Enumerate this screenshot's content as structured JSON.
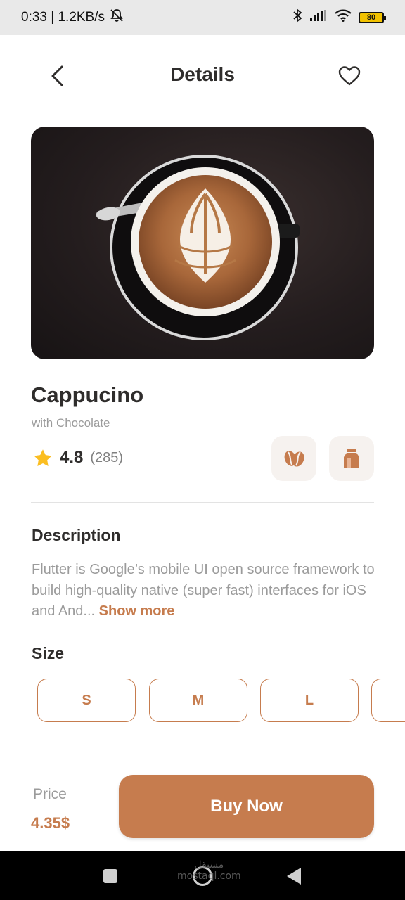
{
  "status_bar": {
    "time_speed": "0:33 | 1.2KB/s",
    "battery": "80",
    "icons": [
      "mute-icon",
      "bluetooth-icon",
      "signal-icon",
      "wifi-icon",
      "battery-icon"
    ]
  },
  "header": {
    "title": "Details",
    "back_icon": "chevron-left-icon",
    "favorite_icon": "heart-outline-icon"
  },
  "product": {
    "name": "Cappucino",
    "subtitle": "with Chocolate",
    "rating": "4.8",
    "rating_count": "(285)",
    "features": [
      "coffee-bean-icon",
      "milk-icon"
    ]
  },
  "description": {
    "title": "Description",
    "text": "Flutter is Google’s mobile UI open source framework to build high-quality native (super fast) interfaces for iOS and And...",
    "show_more": "Show more"
  },
  "size": {
    "title": "Size",
    "options": [
      "S",
      "M",
      "L"
    ]
  },
  "purchase": {
    "price_label": "Price",
    "price": "4.35$",
    "buy_label": "Buy Now"
  },
  "nav": {
    "watermark_line1": "مستقل",
    "watermark_line2": "mostaql.com"
  },
  "colors": {
    "accent": "#c67c4e",
    "text": "#2f2d2c",
    "muted": "#9b9b9b",
    "star": "#fbbe21",
    "feature_bg": "#f6f2ef"
  }
}
